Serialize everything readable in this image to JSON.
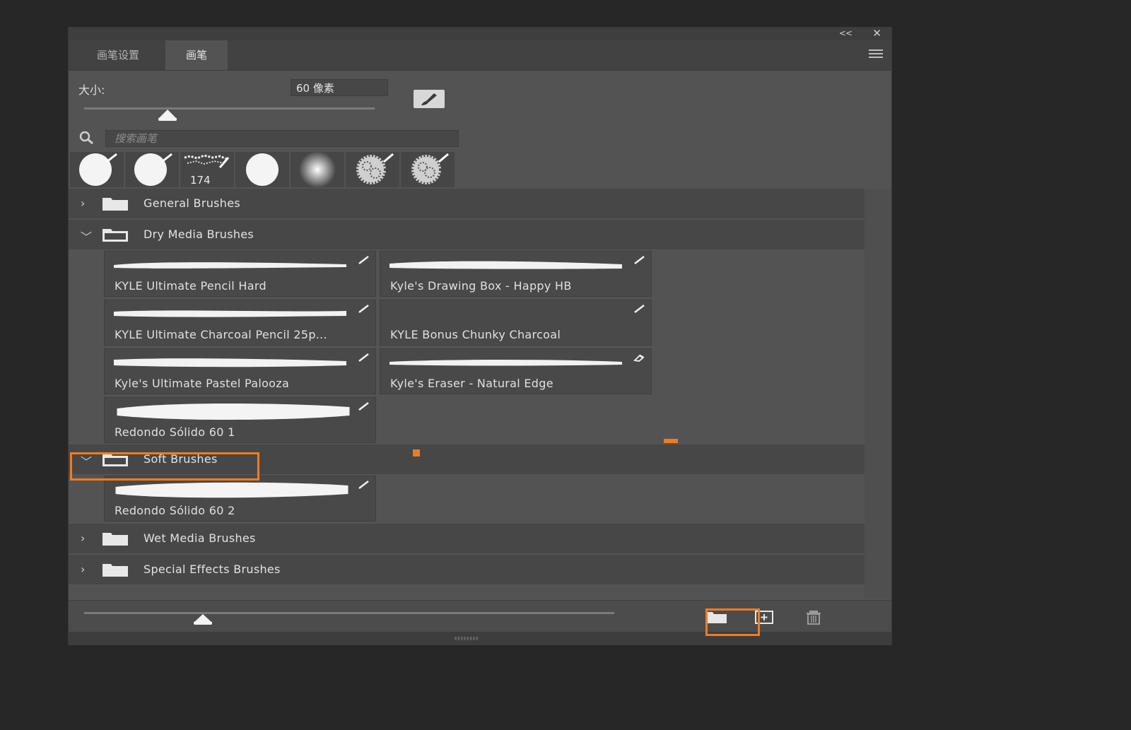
{
  "window": {
    "collapse_glyph": "<<",
    "close_glyph": "✕"
  },
  "tabs": [
    {
      "label": "画笔设置",
      "active": false
    },
    {
      "label": "画笔",
      "active": true
    }
  ],
  "size": {
    "label": "大小:",
    "value": "60 像素"
  },
  "search": {
    "placeholder": "搜索画笔"
  },
  "recent_brushes": [
    {
      "icon": "hard-round-brush-icon"
    },
    {
      "icon": "hard-round-brush-icon"
    },
    {
      "icon": "scatter-brush-icon",
      "count": "174"
    },
    {
      "icon": "hard-round-brush-icon"
    },
    {
      "icon": "soft-round-brush-icon"
    },
    {
      "icon": "textured-brush-icon"
    },
    {
      "icon": "textured-brush-icon"
    }
  ],
  "groups": [
    {
      "name": "General Brushes",
      "expanded": false,
      "chevron": "›"
    },
    {
      "name": "Dry Media Brushes",
      "expanded": true,
      "chevron": "﹀",
      "brushes": [
        "KYLE Ultimate Pencil Hard",
        "Kyle's Drawing Box - Happy HB",
        "KYLE Ultimate Charcoal Pencil 25p...",
        "KYLE Bonus Chunky Charcoal",
        "Kyle's Ultimate Pastel Palooza",
        "Kyle's Eraser - Natural Edge",
        "Redondo Sólido 60 1"
      ]
    },
    {
      "name": "Soft Brushes",
      "expanded": true,
      "chevron": "﹀",
      "highlighted": true,
      "brushes": [
        "Redondo Sólido 60 2"
      ]
    },
    {
      "name": "Wet Media Brushes",
      "expanded": false,
      "chevron": "›"
    },
    {
      "name": "Special Effects Brushes",
      "expanded": false,
      "chevron": "›"
    }
  ],
  "footer": {
    "buttons": [
      {
        "icon": "new-group-folder-icon",
        "highlighted": true
      },
      {
        "icon": "new-brush-icon"
      },
      {
        "icon": "trash-icon"
      }
    ]
  },
  "colors": {
    "highlight": "#f07c20",
    "panel": "#535353",
    "background": "#272727"
  }
}
